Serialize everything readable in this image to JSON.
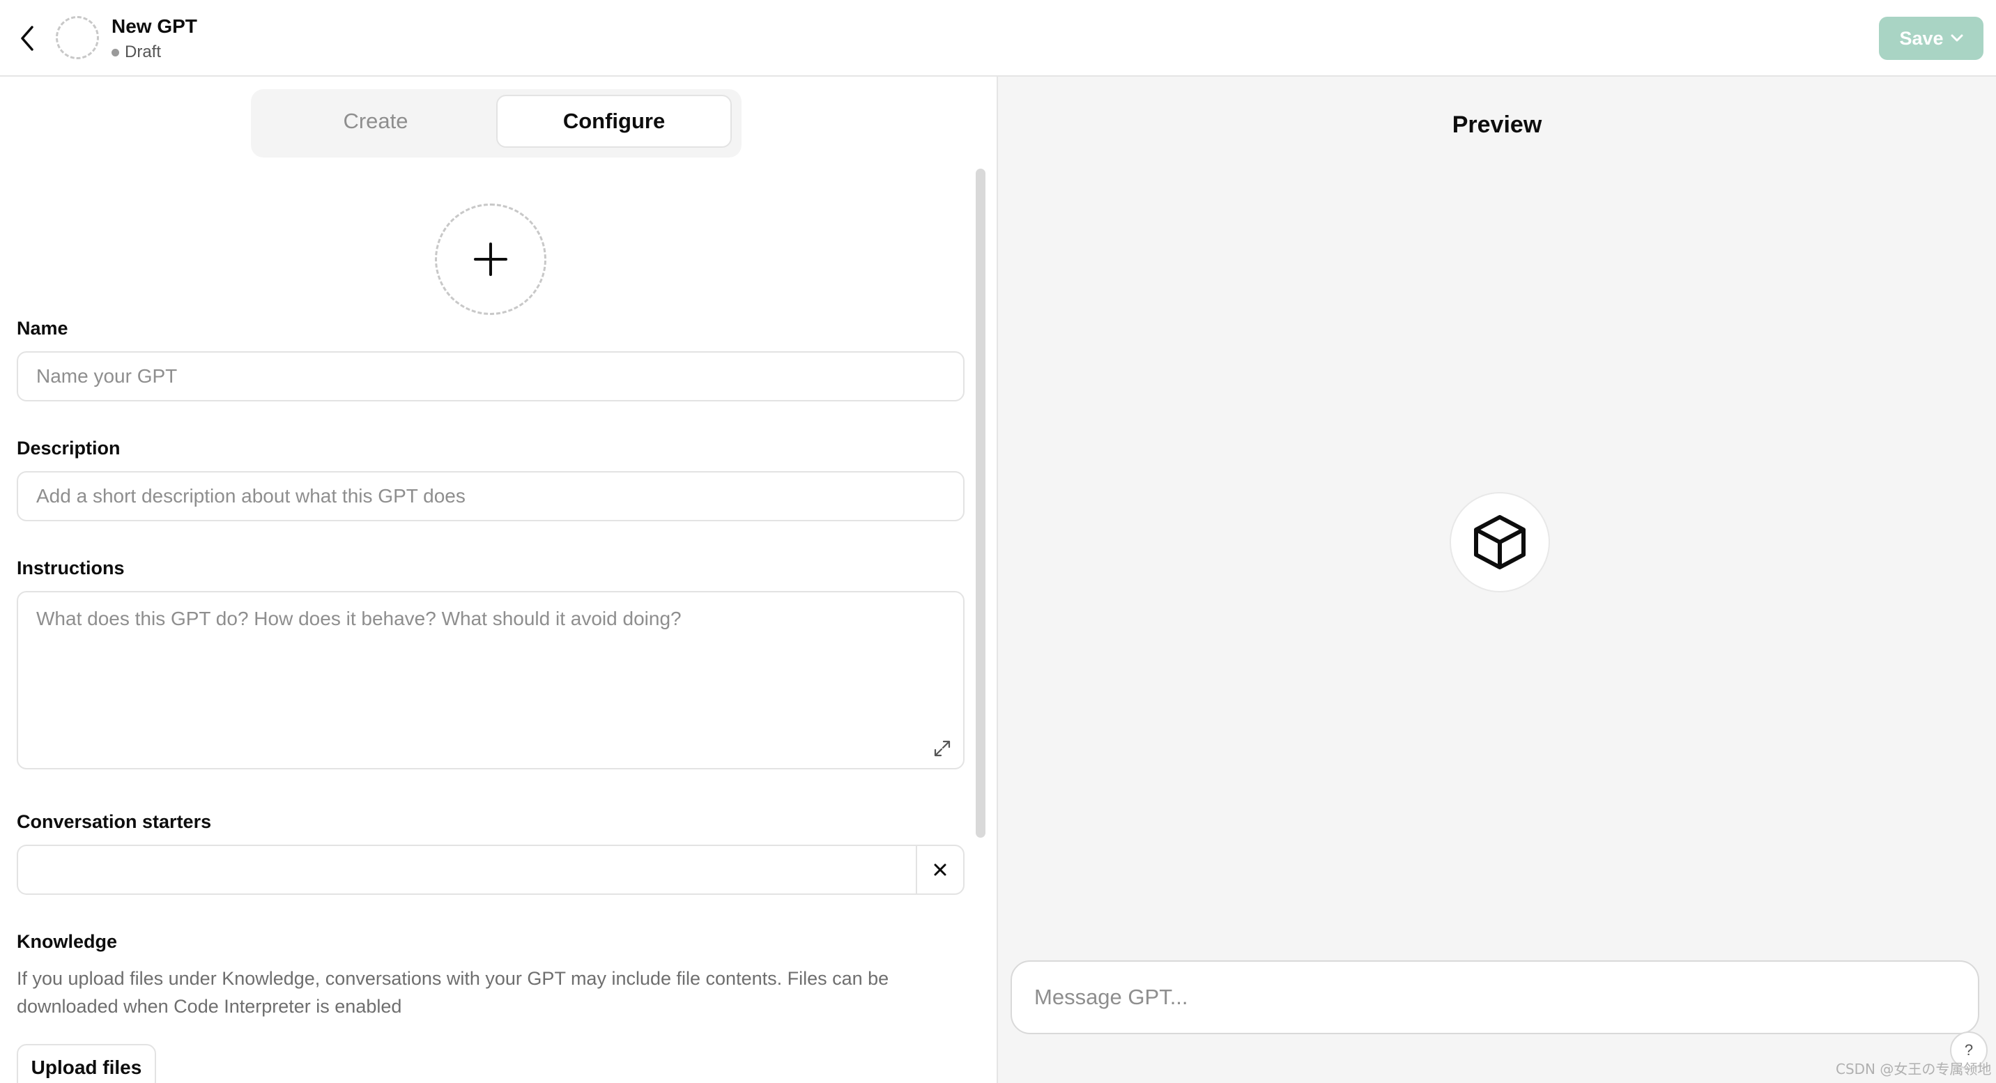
{
  "header": {
    "back_icon": "chevron-left-icon",
    "gpt_name": "New GPT",
    "status": "Draft",
    "save_label": "Save",
    "save_color": "#a9d4c4"
  },
  "tabs": [
    {
      "label": "Create",
      "active": false
    },
    {
      "label": "Configure",
      "active": true
    }
  ],
  "form": {
    "avatar_icon": "plus-icon",
    "name": {
      "label": "Name",
      "placeholder": "Name your GPT",
      "value": ""
    },
    "description": {
      "label": "Description",
      "placeholder": "Add a short description about what this GPT does",
      "value": ""
    },
    "instructions": {
      "label": "Instructions",
      "placeholder": "What does this GPT do? How does it behave? What should it avoid doing?",
      "value": ""
    },
    "conversation_starters": {
      "label": "Conversation starters",
      "value": ""
    },
    "knowledge": {
      "label": "Knowledge",
      "help": "If you upload files under Knowledge, conversations with your GPT may include file contents. Files can be downloaded when Code Interpreter is enabled",
      "upload_label": "Upload files"
    }
  },
  "preview": {
    "title": "Preview",
    "avatar_icon": "cube-icon",
    "message_placeholder": "Message GPT...",
    "help_label": "?"
  },
  "watermark": "CSDN @女王の专属领地"
}
